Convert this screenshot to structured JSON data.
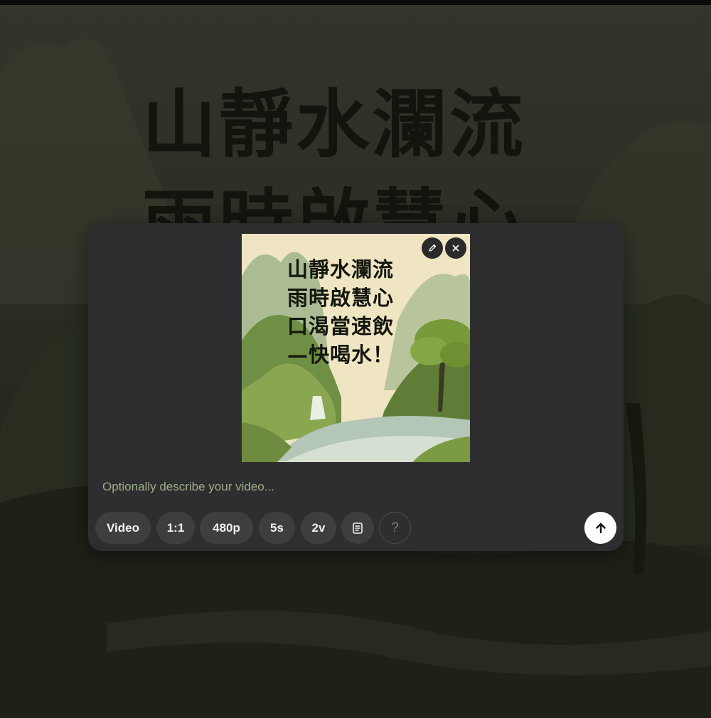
{
  "background": {
    "calligraphy_lines": [
      "山靜水瀾流",
      "雨時啟慧心"
    ]
  },
  "media": {
    "poem_lines": [
      "山靜水瀾流",
      "雨時啟慧心",
      "口渴當速飲",
      "—快喝水！"
    ],
    "edit_icon": "pencil-icon",
    "remove_icon": "close-icon"
  },
  "prompt": {
    "value": "",
    "placeholder": "Optionally describe your video..."
  },
  "toolbar": {
    "mode_label": "Video",
    "aspect_label": "1:1",
    "resolution_label": "480p",
    "duration_label": "5s",
    "variants_label": "2v",
    "preset_icon": "document-icon",
    "help_label": "?",
    "send_icon": "arrow-up-icon"
  },
  "colors": {
    "panel": "#2e2e30",
    "chip": "#3e3e40",
    "placeholder": "#9ead86",
    "send_button": "#ffffff"
  }
}
